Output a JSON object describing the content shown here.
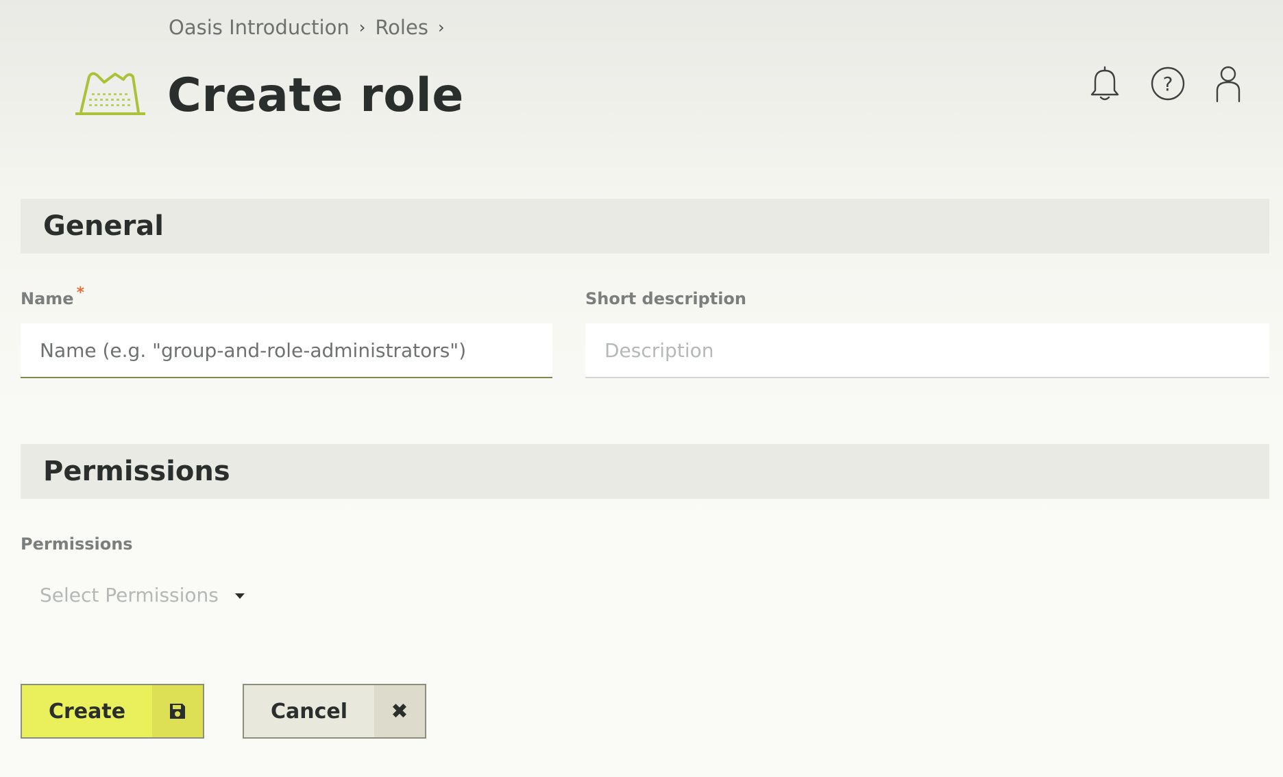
{
  "breadcrumb": {
    "items": [
      "Oasis Introduction",
      "Roles"
    ],
    "separator": "›"
  },
  "header": {
    "title": "Create role",
    "logo_icon": "hat-logo-icon",
    "icons": [
      "bell-icon",
      "help-icon",
      "user-icon"
    ]
  },
  "general": {
    "heading": "General",
    "name": {
      "label": "Name",
      "required_mark": "*",
      "placeholder": "Name (e.g. \"group-and-role-administrators\")",
      "value": ""
    },
    "description": {
      "label": "Short description",
      "placeholder": "Description",
      "value": ""
    }
  },
  "permissions": {
    "heading": "Permissions",
    "label": "Permissions",
    "placeholder": "Select Permissions"
  },
  "actions": {
    "create_label": "Create",
    "create_icon": "save-icon",
    "cancel_label": "Cancel",
    "cancel_icon": "close-icon",
    "cancel_symbol": "✖"
  },
  "colors": {
    "accent": "#e9f05c",
    "required": "#e0713d",
    "logo": "#a9c23a"
  }
}
